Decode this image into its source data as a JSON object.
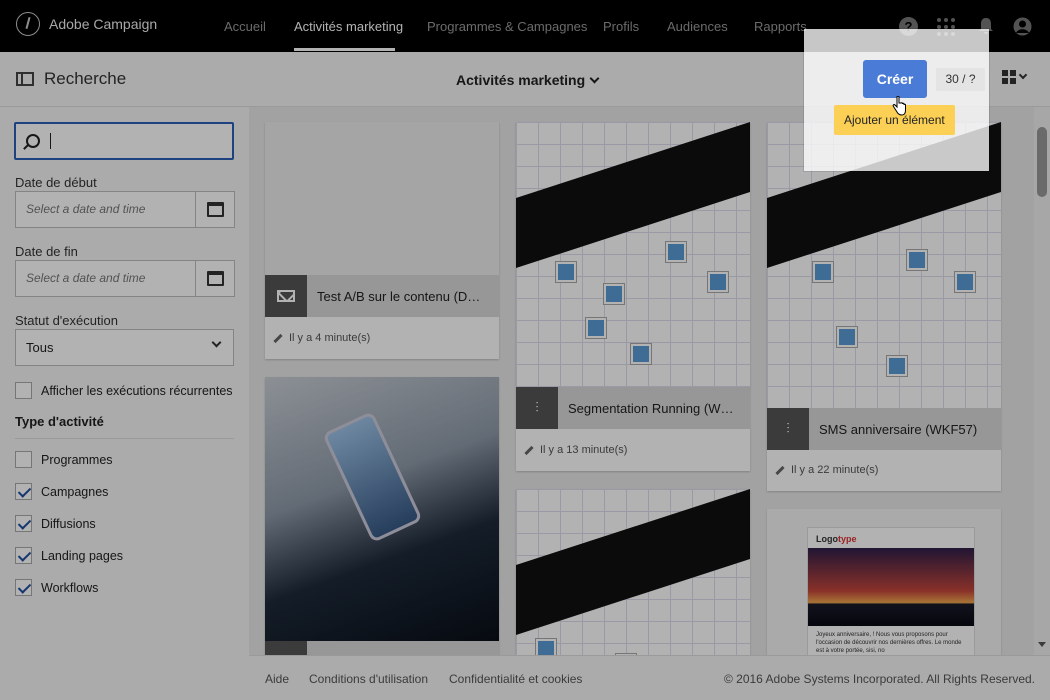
{
  "app": {
    "name": "Adobe Campaign"
  },
  "nav": {
    "items": [
      {
        "label": "Accueil"
      },
      {
        "label": "Activités marketing"
      },
      {
        "label": "Programmes & Campagnes"
      },
      {
        "label": "Profils"
      },
      {
        "label": "Audiences"
      },
      {
        "label": "Rapports"
      }
    ],
    "active": "Activités marketing",
    "icons": [
      "help-icon",
      "apps-icon",
      "bell-icon",
      "user-icon"
    ],
    "help_glyph": "?"
  },
  "toolbar": {
    "search_toggle_label": "Recherche",
    "view_title": "Activités marketing",
    "create_label": "Créer",
    "count": "30 / ?",
    "tooltip": "Ajouter un élément"
  },
  "sidebar": {
    "search_value": "",
    "start_date_label": "Date de début",
    "end_date_label": "Date de fin",
    "date_placeholder": "Select a date and time",
    "status_label": "Statut d'exécution",
    "status_value": "Tous",
    "recurring_label": "Afficher les exécutions récurrentes",
    "recurring_checked": false,
    "activity_type_title": "Type d'activité",
    "activity_types": [
      {
        "label": "Programmes",
        "checked": false
      },
      {
        "label": "Campagnes",
        "checked": true
      },
      {
        "label": "Diffusions",
        "checked": true
      },
      {
        "label": "Landing pages",
        "checked": true
      },
      {
        "label": "Workflows",
        "checked": true
      }
    ]
  },
  "cards": [
    {
      "title": "Test A/B sur le contenu (DM...",
      "meta": "Il y a 4 minute(s)",
      "icon": "email-icon",
      "thumb": "blank"
    },
    {
      "title": "Segmentation Running (WK...",
      "meta": "Il y a 13 minute(s)",
      "icon": "workflow-icon",
      "thumb": "workflow"
    },
    {
      "title": "SMS anniversaire (WKF57)",
      "meta": "Il y a 22 minute(s)",
      "icon": "workflow-icon",
      "thumb": "workflow"
    },
    {
      "title": "",
      "meta": "",
      "icon": "email-icon",
      "thumb": "email-template"
    },
    {
      "title": "",
      "meta": "",
      "icon": "workflow-icon",
      "thumb": "workflow"
    },
    {
      "title": "",
      "meta": "",
      "icon": "email-icon",
      "thumb": "birthday-email"
    }
  ],
  "thumb_text": {
    "birthday_logo_a": "Logo",
    "birthday_logo_b": "type",
    "birthday_text": "Joyeux anniversaire, ! Nous vous proposons pour l'occasion de découvrir nos dernières offres. Le monde est à votre portée, sisi, no"
  },
  "footer": {
    "links": [
      "Aide",
      "Conditions d'utilisation",
      "Confidentialité et cookies"
    ],
    "copyright": "© 2016 Adobe Systems Incorporated. All Rights Reserved."
  },
  "colors": {
    "accent": "#4a7bd6",
    "tooltip": "#fbd055",
    "nav_bg": "#000000"
  }
}
